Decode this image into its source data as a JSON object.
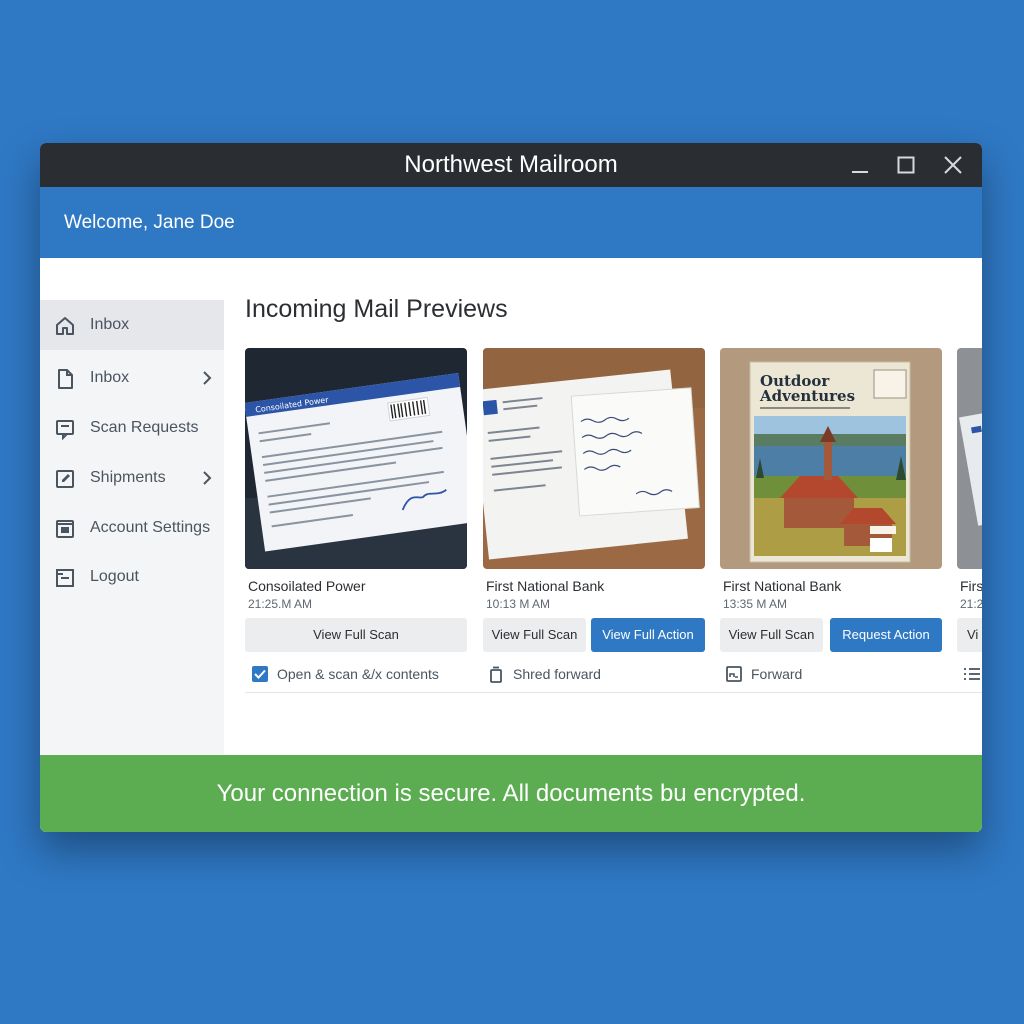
{
  "window": {
    "title": "Northwest Mailroom",
    "controls": [
      "minimize-icon",
      "maximize-icon",
      "close-icon"
    ]
  },
  "header": {
    "welcome": "Welcome, Jane Doe"
  },
  "sidebar": {
    "items": [
      {
        "label": "Inbox",
        "icon": "home-icon",
        "active": true,
        "has_submenu": false
      },
      {
        "label": "Inbox",
        "icon": "document-icon",
        "active": false,
        "has_submenu": true
      },
      {
        "label": "Scan Requests",
        "icon": "scan-request-icon",
        "active": false,
        "has_submenu": false
      },
      {
        "label": "Shipments",
        "icon": "shipment-edit-icon",
        "active": false,
        "has_submenu": true
      },
      {
        "label": "Account Settings",
        "icon": "account-settings-icon",
        "active": false,
        "has_submenu": false
      },
      {
        "label": "Logout",
        "icon": "logout-icon",
        "active": false,
        "has_submenu": false
      }
    ]
  },
  "main": {
    "title": "Incoming Mail Previews",
    "cards": [
      {
        "sender": "Consoilated Power",
        "time": "21:25.M AM",
        "buttons": [
          "View Full Scan"
        ],
        "option": {
          "label": "Open & scan &/x contents",
          "icon": "checkbox-icon",
          "checked": true
        },
        "letterhead": "Consoilated Power"
      },
      {
        "sender": "First National Bank",
        "time": "10:13 M AM",
        "buttons": [
          "View Full Scan",
          "View Full Action"
        ],
        "option": {
          "label": "Shred forward",
          "icon": "trash-icon"
        }
      },
      {
        "sender": "First National Bank",
        "time": "13:35 M AM",
        "buttons": [
          "View Full Scan",
          "Request Action"
        ],
        "option": {
          "label": "Forward",
          "icon": "forward-icon"
        },
        "magazine_title_line1": "Outdoor",
        "magazine_title_line2": "Adventures"
      },
      {
        "sender": "Firs",
        "time": "21:2",
        "buttons": [
          "Vi"
        ],
        "option": {
          "label": "",
          "icon": "list-icon"
        }
      }
    ]
  },
  "footer": {
    "secure_message": "Your connection is secure. All documents bu encrypted."
  },
  "colors": {
    "background": "#2f78c4",
    "titlebar": "#2a2e33",
    "accent": "#2f78c4",
    "secure": "#5cad52",
    "sidebar": "#f4f5f7"
  }
}
